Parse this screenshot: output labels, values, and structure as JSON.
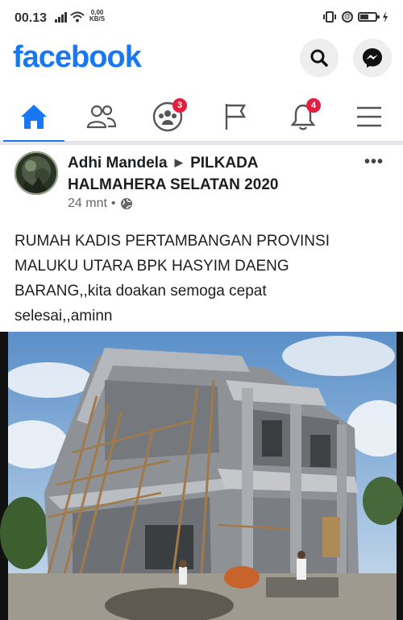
{
  "status_bar": {
    "time": "00.13",
    "speed_value": "0,00",
    "speed_unit": "KB/S"
  },
  "header": {
    "logo": "facebook",
    "brand_color": "#1877f2",
    "actions": [
      {
        "icon": "search-icon"
      },
      {
        "icon": "messenger-icon"
      }
    ]
  },
  "nav": {
    "tabs": [
      {
        "icon": "home-icon",
        "active": true
      },
      {
        "icon": "friends-icon"
      },
      {
        "icon": "groups-icon",
        "badge": "3"
      },
      {
        "icon": "pages-flag-icon"
      },
      {
        "icon": "notifications-bell-icon",
        "badge": "4"
      },
      {
        "icon": "menu-icon"
      }
    ]
  },
  "post": {
    "author": "Adhi Mandela",
    "group": "PILKADA HALMAHERA SELATAN 2020",
    "time": "24 mnt",
    "separator": "•",
    "text_line1": "RUMAH KADIS PERTAMBANGAN PROVINSI",
    "text_line2": "MALUKU UTARA BPK HASYIM DAENG",
    "text_line3": "BARANG,,kita doakan semoga cepat",
    "text_line4": "selesai,,aminn",
    "more": "•••",
    "photo_subject": "house-under-construction-photo"
  }
}
